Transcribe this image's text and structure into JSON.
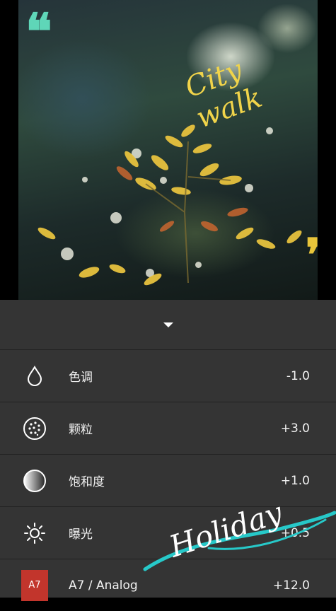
{
  "photo": {
    "sticker_text": "City walk",
    "quote_left": "❝",
    "quote_right": "❞"
  },
  "overlay": {
    "signature_text": "Holiday",
    "accent_color": "#27c9c9"
  },
  "panel": {
    "collapse_icon": "chevron-down-icon",
    "rows": [
      {
        "icon": "drop-icon",
        "label": "色调",
        "value": "-1.0"
      },
      {
        "icon": "grain-icon",
        "label": "颗粒",
        "value": "+3.0"
      },
      {
        "icon": "saturation-icon",
        "label": "饱和度",
        "value": "+1.0"
      },
      {
        "icon": "exposure-icon",
        "label": "曝光",
        "value": "+0.5"
      },
      {
        "icon": "preset-badge",
        "badge": "A7",
        "label": "A7 / Analog",
        "value": "+12.0"
      }
    ]
  },
  "colors": {
    "panel_bg": "#343434",
    "preset_red": "#c2352c",
    "quote_teal": "#5fd6b8",
    "quote_yellow": "#e9c53a"
  }
}
